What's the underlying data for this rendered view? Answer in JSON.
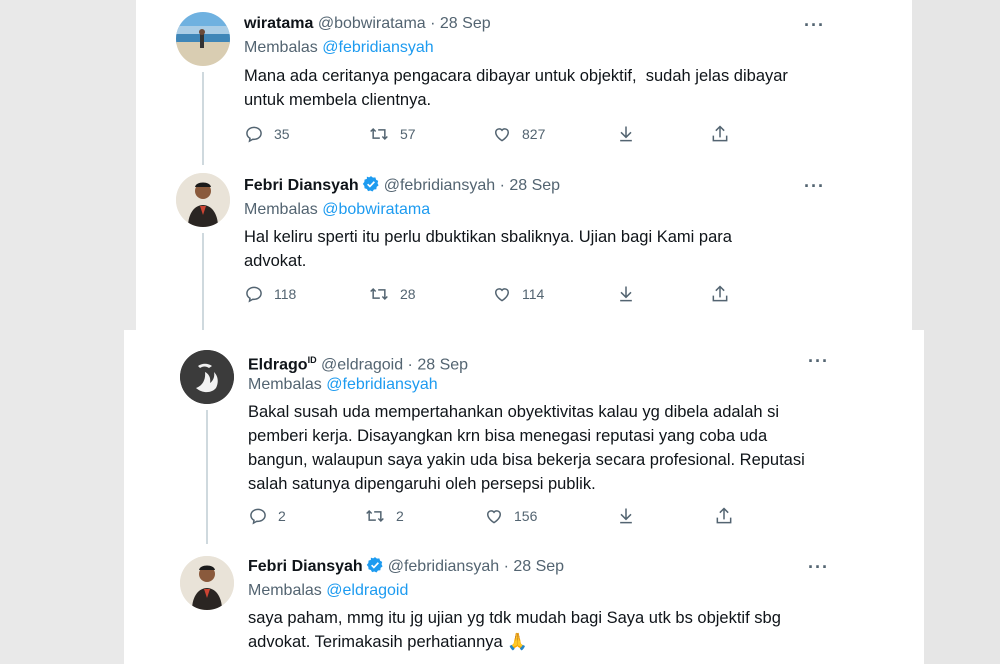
{
  "tweets": [
    {
      "name": "wiratama",
      "handle": "@bobwiratama",
      "separator": "·",
      "date": "28 Sep",
      "verified": false,
      "reply_prefix": "Membalas",
      "reply_to": "@febridiansyah",
      "text_lines": [
        "Mana ada ceritanya pengacara dibayar untuk objektif,  sudah jelas dibayar",
        "untuk membela clientnya."
      ],
      "replies": "35",
      "retweets": "57",
      "likes": "827",
      "avatar_icon": "beach-photo-avatar"
    },
    {
      "name": "Febri Diansyah",
      "handle": "@febridiansyah",
      "separator": "·",
      "date": "28 Sep",
      "verified": true,
      "reply_prefix": "Membalas",
      "reply_to": "@bobwiratama",
      "text_lines": [
        "Hal keliru sperti itu perlu dbuktikan sbaliknya. Ujian bagi Kami para",
        "advokat."
      ],
      "replies": "118",
      "retweets": "28",
      "likes": "114",
      "avatar_icon": "man-portrait-avatar"
    },
    {
      "name": "Eldrago",
      "name_badge": "ID",
      "handle": "@eldragoid",
      "separator": "·",
      "date": "28 Sep",
      "verified": false,
      "reply_prefix": "Membalas",
      "reply_to": "@febridiansyah",
      "text_lines": [
        "Bakal susah uda mempertahankan obyektivitas kalau yg dibela adalah si",
        "pemberi kerja. Disayangkan krn bisa menegasi reputasi yang coba uda",
        "bangun, walaupun saya yakin uda bisa bekerja secara profesional. Reputasi",
        "salah satunya dipengaruhi oleh persepsi publik."
      ],
      "replies": "2",
      "retweets": "2",
      "likes": "156",
      "avatar_icon": "dragon-logo-avatar"
    },
    {
      "name": "Febri Diansyah",
      "handle": "@febridiansyah",
      "separator": "·",
      "date": "28 Sep",
      "verified": true,
      "reply_prefix": "Membalas",
      "reply_to": "@eldragoid",
      "text_lines": [
        "saya paham, mmg itu jg ujian yg tdk mudah bagi Saya utk bs objektif sbg",
        "advokat. Terimakasih perhatiannya"
      ],
      "text_emoji": "🙏",
      "replies": "",
      "retweets": "",
      "likes": "",
      "avatar_icon": "man-portrait-avatar"
    }
  ],
  "colors": {
    "link": "#1d9bf0",
    "muted": "#536471",
    "text": "#0f1419",
    "verified": "#1d9bf0",
    "thread_line": "#cfd9de"
  },
  "icons": [
    "reply-icon",
    "retweet-icon",
    "like-icon",
    "download-icon",
    "share-icon",
    "more-icon",
    "verified-badge-icon"
  ]
}
